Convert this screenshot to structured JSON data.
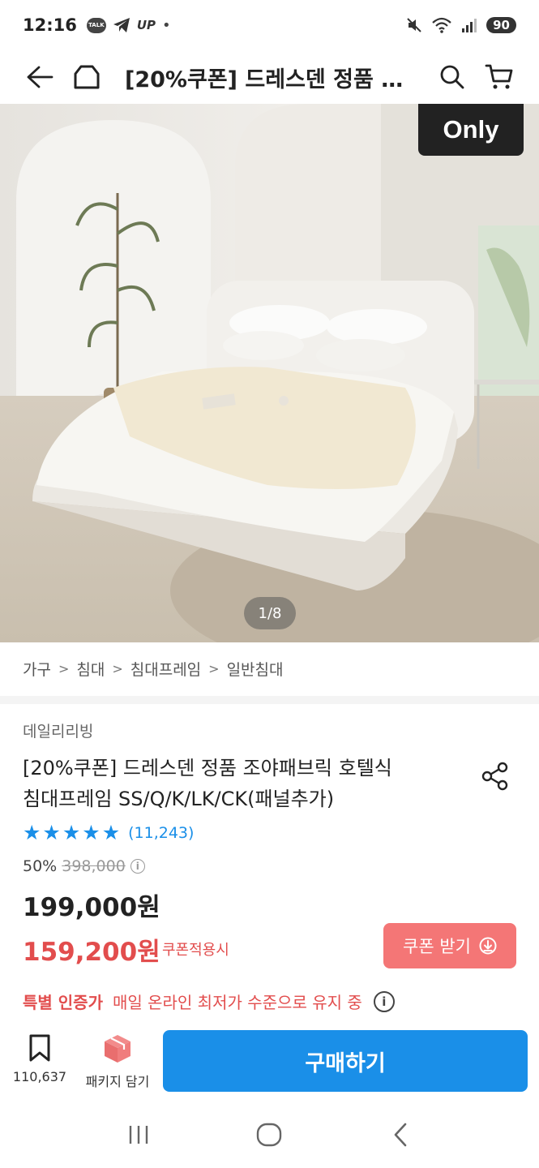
{
  "status_bar": {
    "time": "12:16",
    "talk_label": "TALK",
    "up_label": "UP",
    "dot": "•",
    "battery": "90"
  },
  "app_bar": {
    "title": "[20%쿠폰] 드레스덴 정품 …"
  },
  "hero": {
    "badge": "Only",
    "page_indicator": "1/8"
  },
  "breadcrumb": {
    "items": [
      "가구",
      "침대",
      "침대프레임",
      "일반침대"
    ],
    "separator": ">"
  },
  "product": {
    "brand": "데일리리빙",
    "title_line1": "[20%쿠폰] 드레스덴 정품 조야패브릭 호텔식",
    "title_line2": "침대프레임 SS/Q/K/LK/CK(패널추가)",
    "rating_stars": 5,
    "review_count": "(11,243)",
    "discount_rate": "50%",
    "original_price": "398,000",
    "price": "199,000원",
    "coupon_price": "159,200원",
    "coupon_label": "쿠폰적용시",
    "coupon_button": "쿠폰 받기"
  },
  "certification": {
    "label": "특별 인증가",
    "text": "매일 온라인 최저가 수준으로 유지 중"
  },
  "action_bar": {
    "bookmark_count": "110,637",
    "package_label": "패키지 담기",
    "buy_label": "구매하기"
  },
  "colors": {
    "accent_blue": "#1a8fe8",
    "coupon_red": "#e24d4d",
    "coupon_button": "#f47676"
  }
}
